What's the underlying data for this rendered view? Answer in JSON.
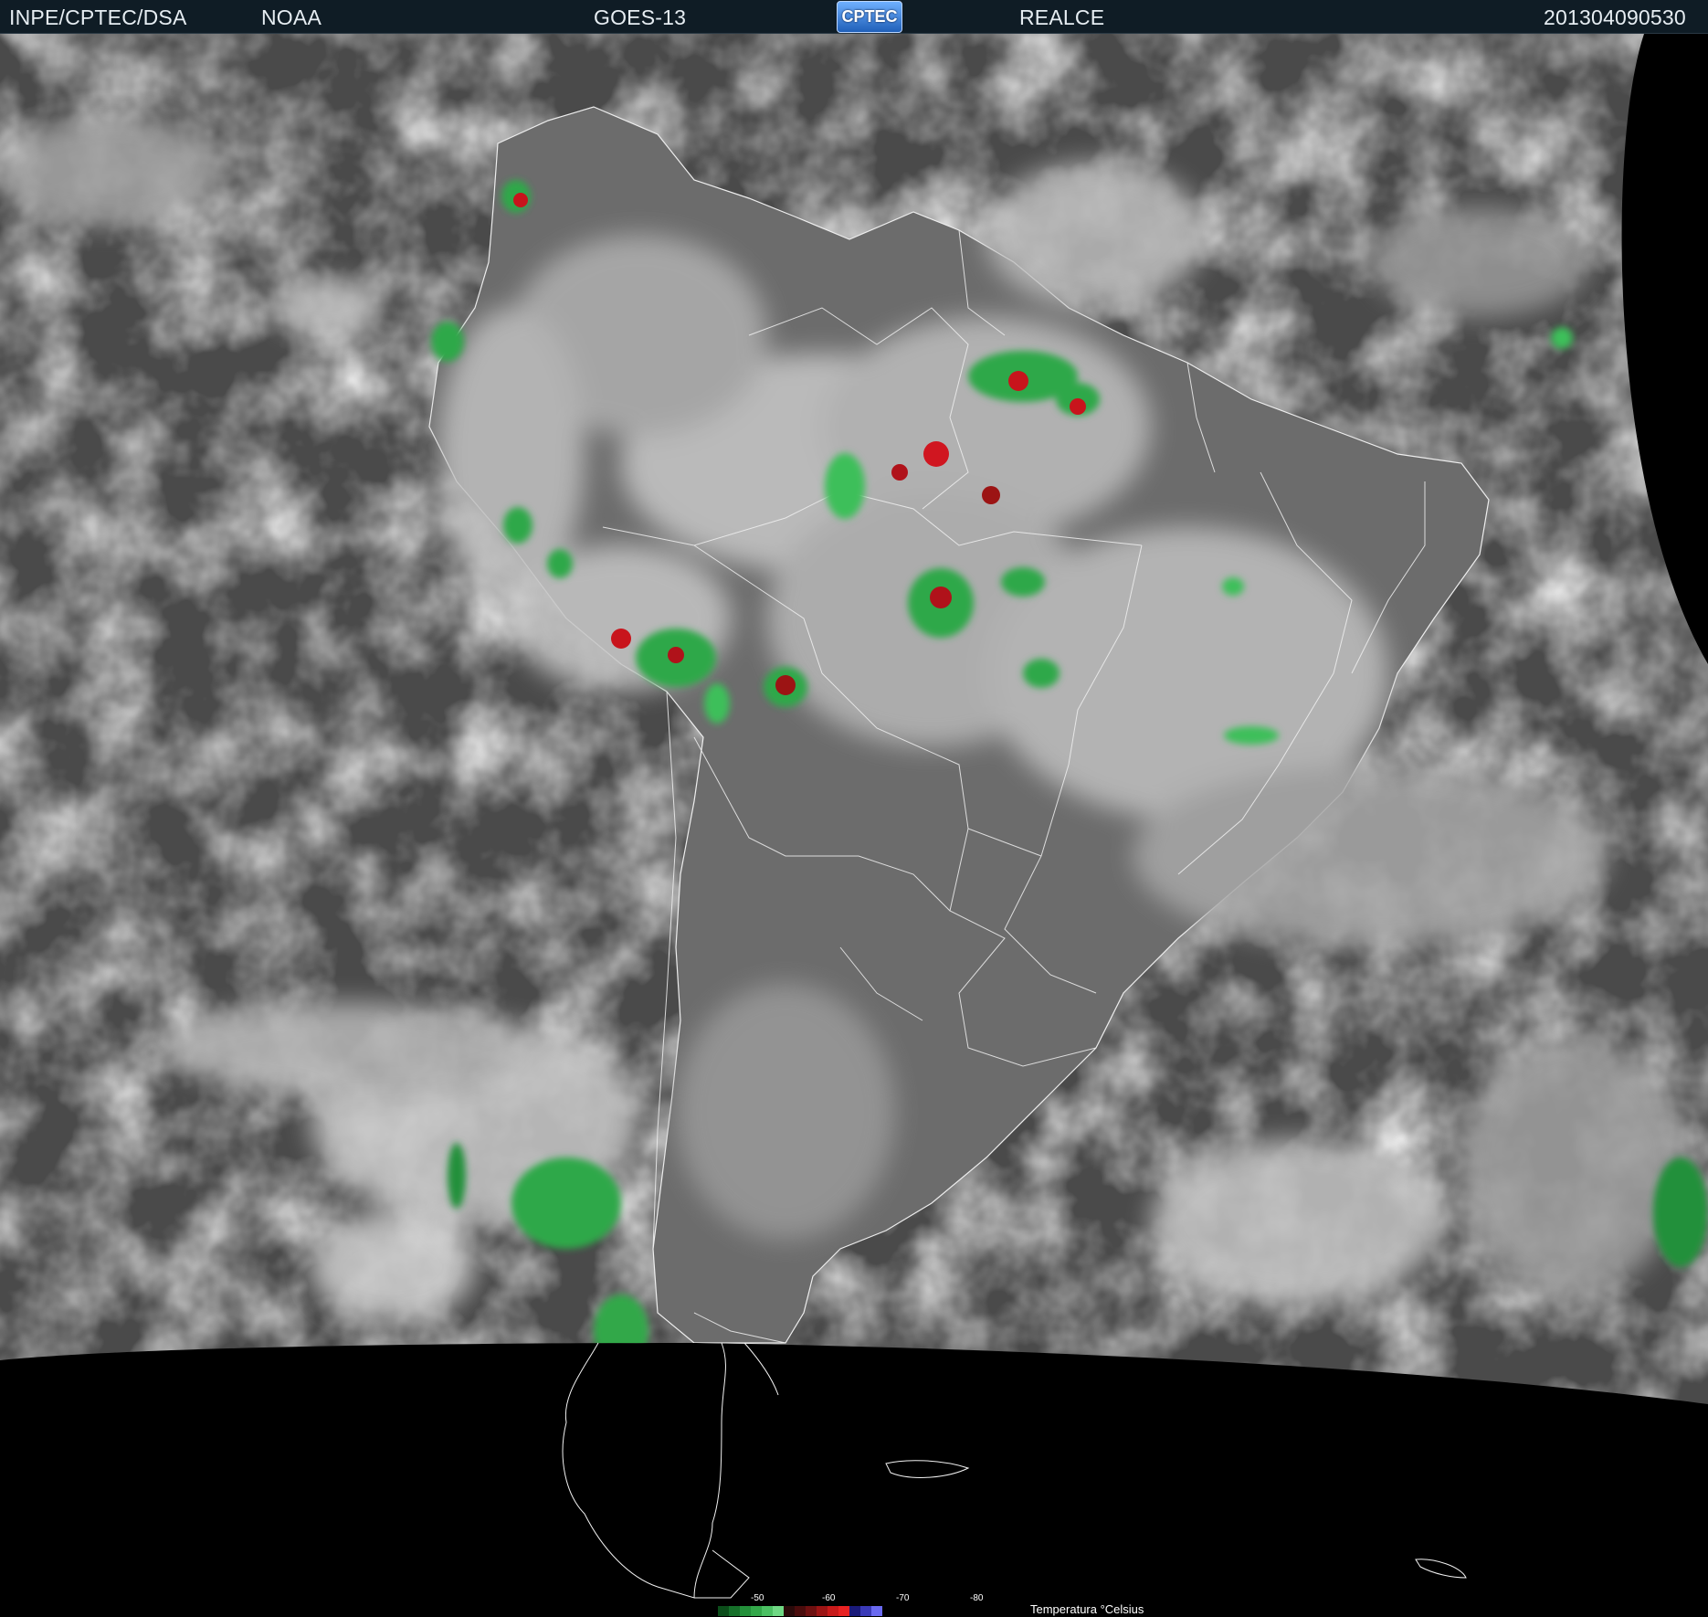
{
  "header": {
    "org": "INPE/CPTEC/DSA",
    "agency": "NOAA",
    "satellite": "GOES-13",
    "logo_text": "CPTEC",
    "product": "REALCE",
    "timestamp": "201304090530"
  },
  "legend": {
    "ticks": [
      "-50",
      "-60",
      "-70",
      "-80"
    ],
    "title": "Temperatura °Celsius",
    "colors": [
      "#0b4d1a",
      "#16702a",
      "#23903a",
      "#33a84a",
      "#4bc063",
      "#6fd884",
      "#2a0a0a",
      "#4a0c0c",
      "#6e1010",
      "#9c1414",
      "#c81a1a",
      "#e82222",
      "#1a1a7a",
      "#3a3ab8",
      "#6a6af0"
    ]
  },
  "colors": {
    "header_bg": "#0f1c25",
    "ocean": "#4c4c4c",
    "land": "#6e6e6e",
    "cloud": "#bdbdbd",
    "earth_edge": "#000000",
    "cold_green": "#2fa84a",
    "cold_red": "#c8141c"
  }
}
